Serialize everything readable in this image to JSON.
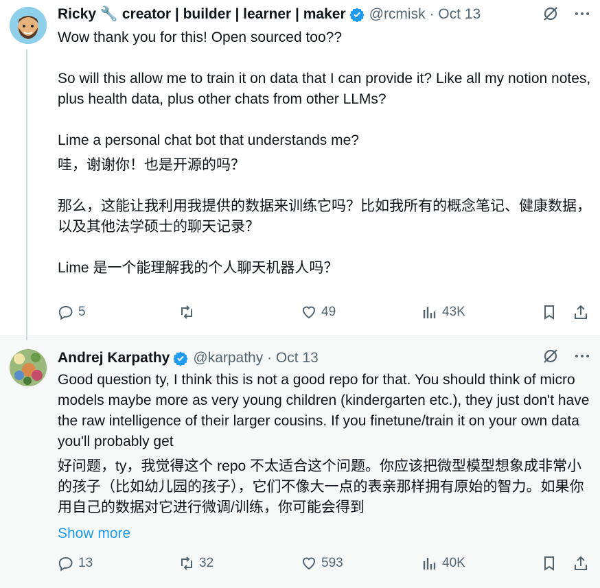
{
  "tweets": [
    {
      "author": "Ricky 🔧 creator | builder | learner | maker",
      "handle": "@rcmisk · Oct 13",
      "text_en": "Wow thank you for this! Open sourced too??\n\nSo will this allow me to train it on data that I can provide it? Like all my notion notes, plus health data, plus other chats from other LLMs?\n\nLime a personal chat bot that understands me?",
      "text_zh": "哇，谢谢你！也是开源的吗？\n\n那么，这能让我利用我提供的数据来训练它吗？比如我所有的概念笔记、健康数据，以及其他法学硕士的聊天记录？\n\nLime 是一个能理解我的个人聊天机器人吗？",
      "replies": "5",
      "retweets": "",
      "likes": "49",
      "views": "43K"
    },
    {
      "author": "Andrej Karpathy",
      "handle": "@karpathy · Oct 13",
      "text_en": "Good question ty, I think this is not a good repo for that. You should think of micro models maybe more as very young children (kindergarten etc.), they just don't have the raw intelligence of their larger cousins. If you finetune/train it on your own data you'll probably get",
      "text_zh": "好问题，ty，我觉得这个 repo 不太适合这个问题。你应该把微型模型想象成非常小的孩子（比如幼儿园的孩子），它们不像大一点的表亲那样拥有原始的智力。如果你用自己的数据对它进行微调/训练，你可能会得到",
      "show_more": "Show more",
      "replies": "13",
      "retweets": "32",
      "likes": "593",
      "views": "40K"
    }
  ],
  "colors": {
    "link": "#1d9bf0",
    "muted": "#536471",
    "verified": "#1d9bf0"
  }
}
